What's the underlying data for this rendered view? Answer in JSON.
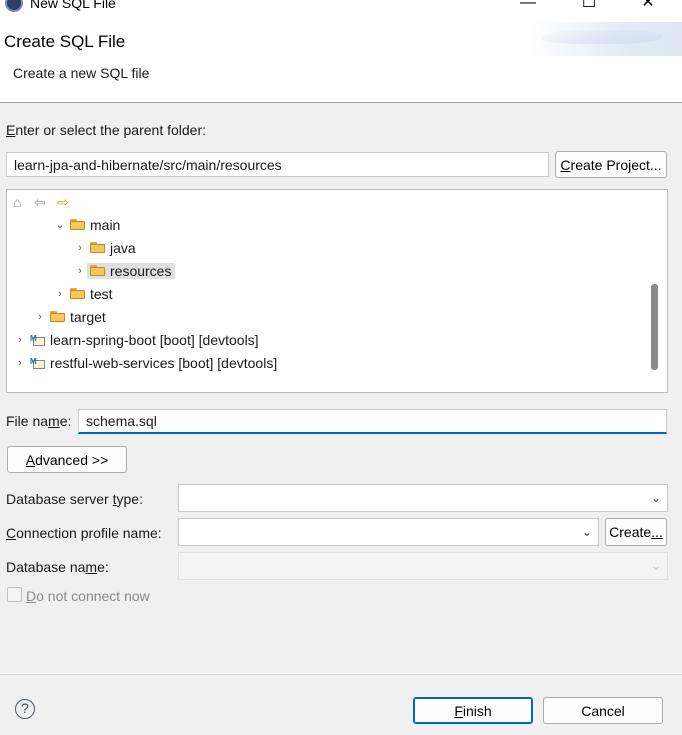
{
  "window": {
    "title": "New SQL File",
    "minimize_glyph": "—",
    "maximize_glyph": "☐",
    "close_glyph": "✕"
  },
  "banner": {
    "heading": "Create SQL File",
    "description": "Create a new SQL file"
  },
  "parent_folder": {
    "label_accel": "E",
    "label_rest": "nter or select the parent folder:",
    "value": "learn-jpa-and-hibernate/src/main/resources",
    "create_project_accel": "C",
    "create_project_rest": "reate Project..."
  },
  "tree": {
    "nav_icons": [
      "home-icon",
      "back-arrow-icon",
      "forward-arrow-icon"
    ],
    "items": [
      {
        "label": "main",
        "expanded": true
      },
      {
        "label": "java",
        "expanded": false
      },
      {
        "label": "resources",
        "expanded": false,
        "selected": true
      },
      {
        "label": "test",
        "expanded": false
      },
      {
        "label": "target",
        "expanded": false
      },
      {
        "label": "learn-spring-boot [boot] [devtools]",
        "expanded": false
      },
      {
        "label": "restful-web-services [boot] [devtools]",
        "expanded": false
      }
    ]
  },
  "file_name": {
    "label_pre": "File na",
    "label_accel": "m",
    "label_post": "e:",
    "value": "schema.sql"
  },
  "advanced": {
    "accel": "A",
    "rest": "dvanced >>"
  },
  "database_server_type": {
    "label_pre": "Database server ",
    "label_accel": "t",
    "label_post": "ype:",
    "value": ""
  },
  "connection_profile": {
    "label_accel": "C",
    "label_rest": "onnection profile name:",
    "value": "",
    "create_pre": "Create",
    "create_post": "..."
  },
  "database_name": {
    "label_pre": "Database na",
    "label_accel": "m",
    "label_post": "e:",
    "value": ""
  },
  "do_not_connect": {
    "accel": "D",
    "rest": "o not connect now",
    "checked": false
  },
  "footer": {
    "help_glyph": "?",
    "finish_accel": "F",
    "finish_rest": "inish",
    "cancel": "Cancel"
  },
  "colors": {
    "accent": "#0067c0",
    "folder": "#f5c75a",
    "selection": "#e0e0e0"
  }
}
